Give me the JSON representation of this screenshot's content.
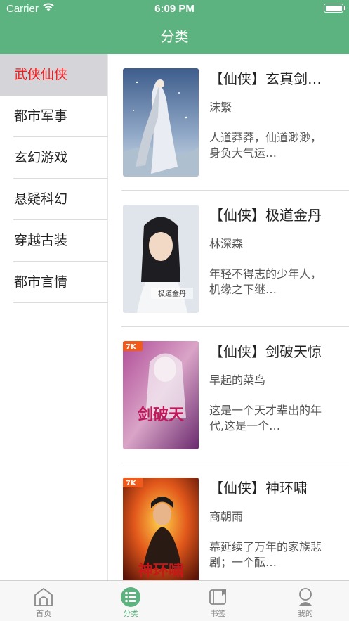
{
  "status_bar": {
    "carrier": "Carrier",
    "time": "6:09 PM"
  },
  "nav": {
    "title": "分类"
  },
  "categories": [
    {
      "label": "武侠仙侠",
      "active": true
    },
    {
      "label": "都市军事",
      "active": false
    },
    {
      "label": "玄幻游戏",
      "active": false
    },
    {
      "label": "悬疑科幻",
      "active": false
    },
    {
      "label": "穿越古装",
      "active": false
    },
    {
      "label": "都市言情",
      "active": false
    }
  ],
  "books": [
    {
      "title": "【仙侠】玄真剑…",
      "author": "沫繁",
      "desc": "人道莽莽，仙道渺渺， 身负大气运…"
    },
    {
      "title": "【仙侠】极道金丹",
      "author": "林深森",
      "desc": "年轻不得志的少年人，机缘之下继…",
      "cover_text": "极道金丹"
    },
    {
      "title": "【仙侠】剑破天惊",
      "author": "早起的菜鸟",
      "desc": "这是一个天才辈出的年代,这是一个…",
      "cover_text": "剑破天"
    },
    {
      "title": "【仙侠】神环啸",
      "author": "商朝雨",
      "desc": "幕延续了万年的家族悲剧；一个酝…",
      "cover_text": "神环啸"
    }
  ],
  "tabbar": [
    {
      "label": "首页",
      "icon": "home-icon",
      "active": false
    },
    {
      "label": "分类",
      "icon": "category-list-icon",
      "active": true
    },
    {
      "label": "书签",
      "icon": "bookmark-icon",
      "active": false
    },
    {
      "label": "我的",
      "icon": "profile-icon",
      "active": false
    }
  ],
  "colors": {
    "theme_green": "#5cb37f",
    "active_red": "#f21b1b",
    "active_bg": "#d4d4d9"
  }
}
